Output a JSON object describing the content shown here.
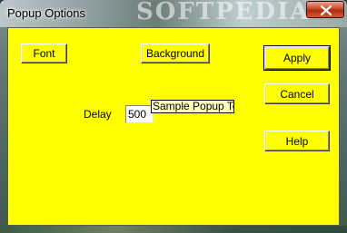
{
  "window": {
    "title": "Popup Options",
    "watermark": "SOFTPEDIA",
    "background_color": "#ffff00"
  },
  "buttons": {
    "font": "Font",
    "background": "Background",
    "apply": "Apply",
    "cancel": "Cancel",
    "help": "Help"
  },
  "delay": {
    "label": "Delay",
    "value": "500"
  },
  "sample_popup": {
    "text": "Sample Popup Tex"
  }
}
